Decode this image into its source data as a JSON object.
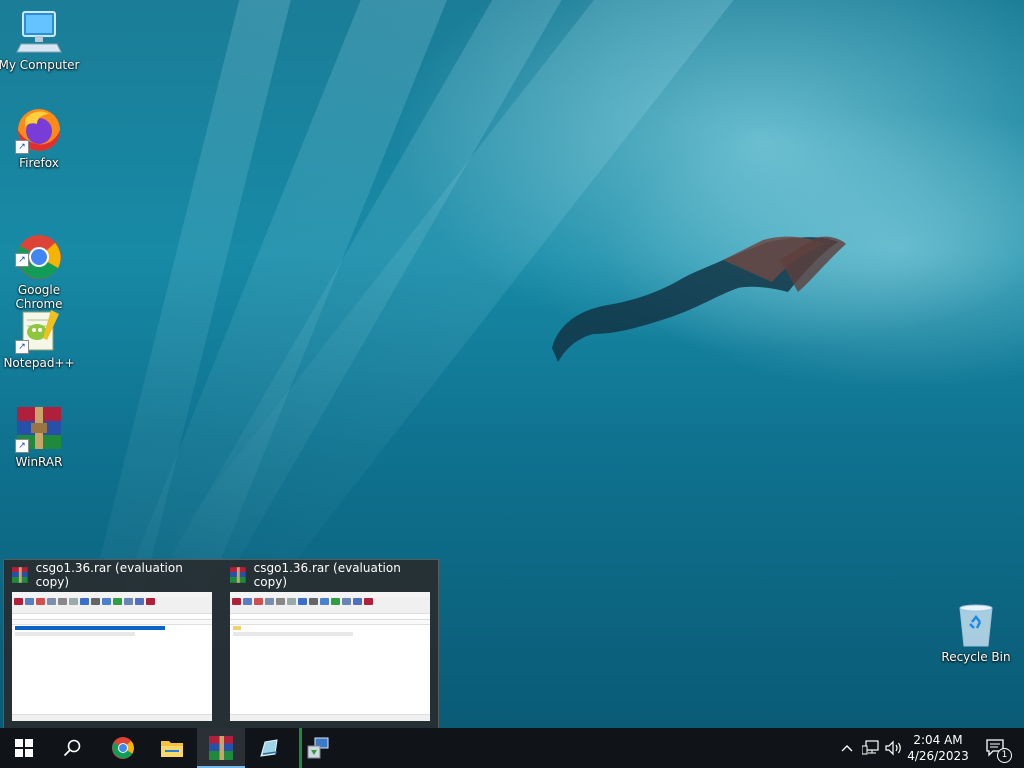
{
  "desktop": {
    "icons": [
      {
        "label": "My Computer"
      },
      {
        "label": "Firefox"
      },
      {
        "label": "Google\nChrome"
      },
      {
        "label": "Notepad++"
      },
      {
        "label": "WinRAR"
      },
      {
        "label": "Recycle Bin"
      }
    ]
  },
  "preview": {
    "windows": [
      {
        "title": "csgo1.36.rar (evaluation copy)"
      },
      {
        "title": "csgo1.36.rar (evaluation copy)"
      }
    ]
  },
  "taskbar": {
    "clock_time": "2:04 AM",
    "clock_date": "4/26/2023",
    "notification_count": "1",
    "accent_color": "#76b9ed"
  }
}
